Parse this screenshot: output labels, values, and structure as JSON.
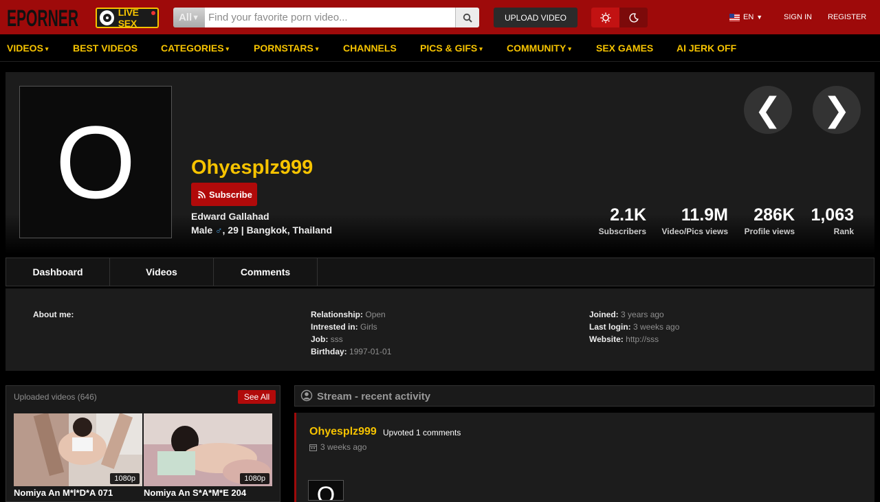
{
  "header": {
    "logo_text": "EPORNER",
    "live_label": "LIVE SEX",
    "search": {
      "category": "All",
      "placeholder": "Find your favorite porn video..."
    },
    "upload_label": "UPLOAD VIDEO",
    "language": "EN",
    "sign_in": "SIGN IN",
    "register": "REGISTER",
    "brand_color": "#9e0a0a",
    "accent_color": "#f6c300"
  },
  "nav": [
    {
      "label": "VIDEOS",
      "caret": "▾"
    },
    {
      "label": "BEST VIDEOS",
      "caret": ""
    },
    {
      "label": "CATEGORIES",
      "caret": "▾"
    },
    {
      "label": "PORNSTARS",
      "caret": "▾"
    },
    {
      "label": "CHANNELS",
      "caret": ""
    },
    {
      "label": "PICS & GIFS",
      "caret": "▾"
    },
    {
      "label": "COMMUNITY",
      "caret": "▾"
    },
    {
      "label": "SEX GAMES",
      "caret": ""
    },
    {
      "label": "AI JERK OFF",
      "caret": ""
    }
  ],
  "profile": {
    "avatar_letter": "O",
    "username": "Ohyesplz999",
    "subscribe_label": "Subscribe",
    "real_name": "Edward Gallahad",
    "gender": "Male",
    "gender_symbol": "♂",
    "age_location": ", 29 | Bangkok, Thailand",
    "prev_arrow": "❮",
    "next_arrow": "❯",
    "stats": [
      {
        "value": "2.1K",
        "label": "Subscribers"
      },
      {
        "value": "11.9M",
        "label": "Video/Pics views"
      },
      {
        "value": "286K",
        "label": "Profile views"
      },
      {
        "value": "1,063",
        "label": "Rank"
      }
    ]
  },
  "tabs": [
    "Dashboard",
    "Videos",
    "Comments"
  ],
  "about": {
    "about_label": "About me:",
    "relationship": {
      "k": "Relationship:",
      "v": "Open"
    },
    "interested": {
      "k": "Intrested in:",
      "v": "Girls"
    },
    "job": {
      "k": "Job:",
      "v": "sss"
    },
    "birthday": {
      "k": "Birthday:",
      "v": "1997-01-01"
    },
    "joined": {
      "k": "Joined:",
      "v": "3 years ago"
    },
    "last_login": {
      "k": "Last login:",
      "v": "3 weeks ago"
    },
    "website": {
      "k": "Website:",
      "v": "http://sss"
    }
  },
  "uploads": {
    "title": "Uploaded videos (646)",
    "see_all": "See All",
    "videos": [
      {
        "title": "Nomiya An M*l*D*A 071",
        "quality": "1080p"
      },
      {
        "title": "Nomiya An S*A*M*E 204",
        "quality": "1080p"
      }
    ]
  },
  "stream": {
    "title": "Stream - recent activity",
    "activity": {
      "user": "Ohyesplz999",
      "action": "Upvoted 1 comments",
      "time": "3 weeks ago",
      "avatar_letter": "O"
    }
  }
}
